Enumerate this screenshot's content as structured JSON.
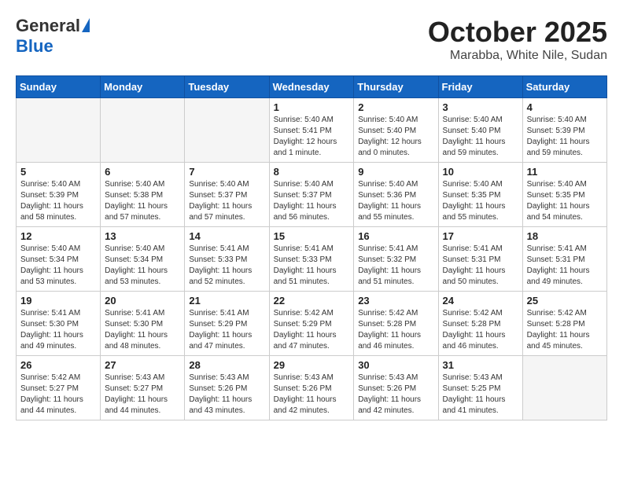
{
  "header": {
    "logo_general": "General",
    "logo_blue": "Blue",
    "title": "October 2025",
    "location": "Marabba, White Nile, Sudan"
  },
  "weekdays": [
    "Sunday",
    "Monday",
    "Tuesday",
    "Wednesday",
    "Thursday",
    "Friday",
    "Saturday"
  ],
  "weeks": [
    [
      {
        "day": "",
        "info": ""
      },
      {
        "day": "",
        "info": ""
      },
      {
        "day": "",
        "info": ""
      },
      {
        "day": "1",
        "info": "Sunrise: 5:40 AM\nSunset: 5:41 PM\nDaylight: 12 hours\nand 1 minute."
      },
      {
        "day": "2",
        "info": "Sunrise: 5:40 AM\nSunset: 5:40 PM\nDaylight: 12 hours\nand 0 minutes."
      },
      {
        "day": "3",
        "info": "Sunrise: 5:40 AM\nSunset: 5:40 PM\nDaylight: 11 hours\nand 59 minutes."
      },
      {
        "day": "4",
        "info": "Sunrise: 5:40 AM\nSunset: 5:39 PM\nDaylight: 11 hours\nand 59 minutes."
      }
    ],
    [
      {
        "day": "5",
        "info": "Sunrise: 5:40 AM\nSunset: 5:39 PM\nDaylight: 11 hours\nand 58 minutes."
      },
      {
        "day": "6",
        "info": "Sunrise: 5:40 AM\nSunset: 5:38 PM\nDaylight: 11 hours\nand 57 minutes."
      },
      {
        "day": "7",
        "info": "Sunrise: 5:40 AM\nSunset: 5:37 PM\nDaylight: 11 hours\nand 57 minutes."
      },
      {
        "day": "8",
        "info": "Sunrise: 5:40 AM\nSunset: 5:37 PM\nDaylight: 11 hours\nand 56 minutes."
      },
      {
        "day": "9",
        "info": "Sunrise: 5:40 AM\nSunset: 5:36 PM\nDaylight: 11 hours\nand 55 minutes."
      },
      {
        "day": "10",
        "info": "Sunrise: 5:40 AM\nSunset: 5:35 PM\nDaylight: 11 hours\nand 55 minutes."
      },
      {
        "day": "11",
        "info": "Sunrise: 5:40 AM\nSunset: 5:35 PM\nDaylight: 11 hours\nand 54 minutes."
      }
    ],
    [
      {
        "day": "12",
        "info": "Sunrise: 5:40 AM\nSunset: 5:34 PM\nDaylight: 11 hours\nand 53 minutes."
      },
      {
        "day": "13",
        "info": "Sunrise: 5:40 AM\nSunset: 5:34 PM\nDaylight: 11 hours\nand 53 minutes."
      },
      {
        "day": "14",
        "info": "Sunrise: 5:41 AM\nSunset: 5:33 PM\nDaylight: 11 hours\nand 52 minutes."
      },
      {
        "day": "15",
        "info": "Sunrise: 5:41 AM\nSunset: 5:33 PM\nDaylight: 11 hours\nand 51 minutes."
      },
      {
        "day": "16",
        "info": "Sunrise: 5:41 AM\nSunset: 5:32 PM\nDaylight: 11 hours\nand 51 minutes."
      },
      {
        "day": "17",
        "info": "Sunrise: 5:41 AM\nSunset: 5:31 PM\nDaylight: 11 hours\nand 50 minutes."
      },
      {
        "day": "18",
        "info": "Sunrise: 5:41 AM\nSunset: 5:31 PM\nDaylight: 11 hours\nand 49 minutes."
      }
    ],
    [
      {
        "day": "19",
        "info": "Sunrise: 5:41 AM\nSunset: 5:30 PM\nDaylight: 11 hours\nand 49 minutes."
      },
      {
        "day": "20",
        "info": "Sunrise: 5:41 AM\nSunset: 5:30 PM\nDaylight: 11 hours\nand 48 minutes."
      },
      {
        "day": "21",
        "info": "Sunrise: 5:41 AM\nSunset: 5:29 PM\nDaylight: 11 hours\nand 47 minutes."
      },
      {
        "day": "22",
        "info": "Sunrise: 5:42 AM\nSunset: 5:29 PM\nDaylight: 11 hours\nand 47 minutes."
      },
      {
        "day": "23",
        "info": "Sunrise: 5:42 AM\nSunset: 5:28 PM\nDaylight: 11 hours\nand 46 minutes."
      },
      {
        "day": "24",
        "info": "Sunrise: 5:42 AM\nSunset: 5:28 PM\nDaylight: 11 hours\nand 46 minutes."
      },
      {
        "day": "25",
        "info": "Sunrise: 5:42 AM\nSunset: 5:28 PM\nDaylight: 11 hours\nand 45 minutes."
      }
    ],
    [
      {
        "day": "26",
        "info": "Sunrise: 5:42 AM\nSunset: 5:27 PM\nDaylight: 11 hours\nand 44 minutes."
      },
      {
        "day": "27",
        "info": "Sunrise: 5:43 AM\nSunset: 5:27 PM\nDaylight: 11 hours\nand 44 minutes."
      },
      {
        "day": "28",
        "info": "Sunrise: 5:43 AM\nSunset: 5:26 PM\nDaylight: 11 hours\nand 43 minutes."
      },
      {
        "day": "29",
        "info": "Sunrise: 5:43 AM\nSunset: 5:26 PM\nDaylight: 11 hours\nand 42 minutes."
      },
      {
        "day": "30",
        "info": "Sunrise: 5:43 AM\nSunset: 5:26 PM\nDaylight: 11 hours\nand 42 minutes."
      },
      {
        "day": "31",
        "info": "Sunrise: 5:43 AM\nSunset: 5:25 PM\nDaylight: 11 hours\nand 41 minutes."
      },
      {
        "day": "",
        "info": ""
      }
    ]
  ]
}
